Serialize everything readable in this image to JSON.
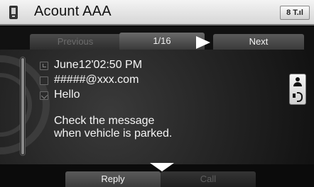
{
  "header": {
    "title": "Acount AAA",
    "status_text": "8 T.ıl",
    "phone_icon": "phone-icon"
  },
  "tabs": {
    "previous": "Previous",
    "page": "1/16",
    "next": "Next"
  },
  "message": {
    "time": "June12'02:50 PM",
    "sender": "#####@xxx.com",
    "subject": "Hello",
    "body_line1": "Check the message",
    "body_line2": "when vehicle is parked."
  },
  "footer": {
    "reply": "Reply",
    "call": "Call"
  },
  "icons": {
    "side_top": "person-icon",
    "side_bottom": "speaker-icon"
  }
}
